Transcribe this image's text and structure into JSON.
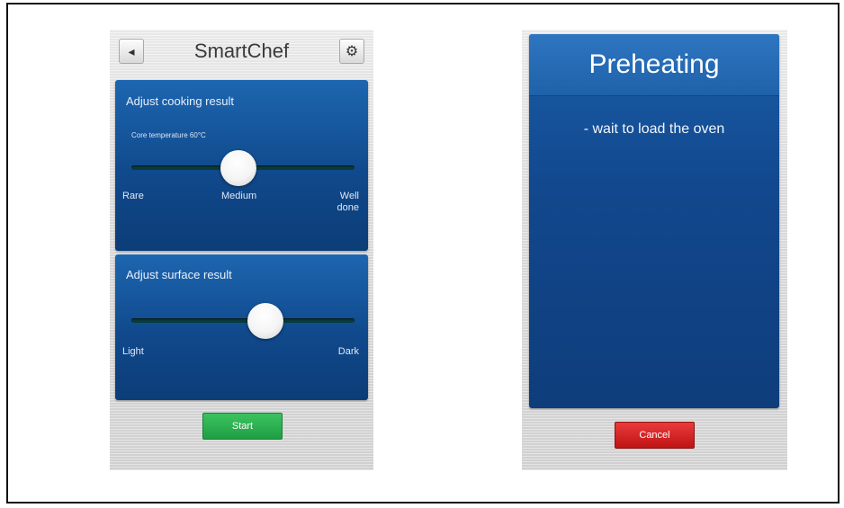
{
  "smartchef_screen": {
    "title": "SmartChef",
    "back_icon": "◂",
    "settings_icon": "⚙",
    "cooking_panel": {
      "title": "Adjust cooking result",
      "core_temperature": "Core temperature 60°C",
      "slider_level_percent": 48,
      "labels": {
        "left": "Rare",
        "center": "Medium",
        "right_line1": "Well",
        "right_line2": "done"
      }
    },
    "surface_panel": {
      "title": "Adjust surface result",
      "slider_level_percent": 60,
      "labels": {
        "left": "Light",
        "right": "Dark"
      }
    },
    "start_button": "Start"
  },
  "preheating_screen": {
    "title": "Preheating",
    "message": "- wait to load the oven",
    "cancel_button": "Cancel"
  },
  "colors": {
    "panel_blue": "#12488e",
    "start_green": "#2db34f",
    "cancel_red": "#d32424"
  }
}
